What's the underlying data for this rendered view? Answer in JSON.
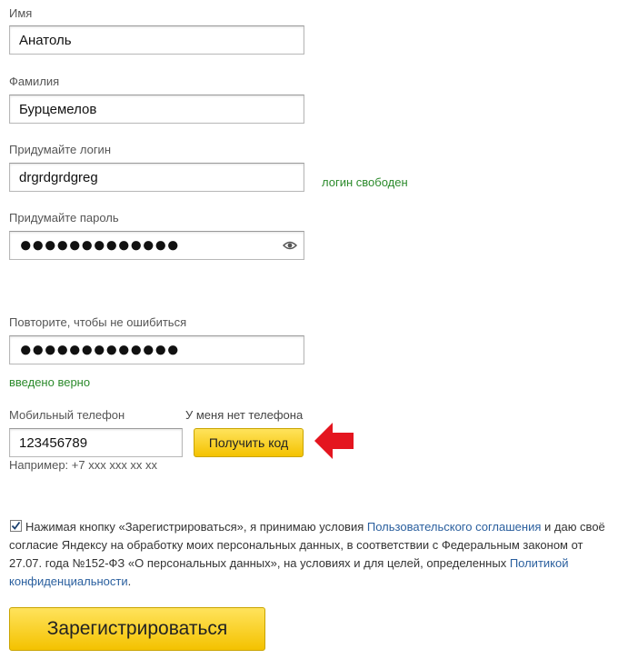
{
  "form": {
    "first_name": {
      "label": "Имя",
      "value": "Анатоль"
    },
    "last_name": {
      "label": "Фамилия",
      "value": "Бурцемелов"
    },
    "login": {
      "label": "Придумайте логин",
      "value": "drgrdgrdgreg",
      "status": "логин свободен"
    },
    "password": {
      "label": "Придумайте пароль",
      "masked": "●●●●●●●●●●●●●",
      "show_icon": "eye-icon"
    },
    "password_repeat": {
      "label": "Повторите, чтобы не ошибиться",
      "masked": "●●●●●●●●●●●●●",
      "status": "введено верно"
    },
    "phone": {
      "label": "Мобильный телефон",
      "no_phone_link": "У меня нет телефона",
      "value": "123456789",
      "get_code_button": "Получить код",
      "example": "Например: +7 xxx xxx xx xx",
      "arrow_icon": "red-arrow-left-icon",
      "arrow_color": "#e4151f"
    },
    "agreement": {
      "checked": true,
      "text_1": "Нажимая кнопку «Зарегистрироваться», я принимаю условия ",
      "link_1": "Пользовательского соглашения",
      "text_2": " и даю своё согласие Яндексу на обработку моих персональных данных, в соответствии с Федеральным законом от 27.07. года №152-ФЗ «О персональных данных», на условиях и для целей, определенных ",
      "link_2": "Политикой конфиденциальности",
      "text_3": "."
    },
    "submit_button": "Зарегистрироваться"
  },
  "colors": {
    "accent_yellow": "#f4c200",
    "success_green": "#2b8a2b",
    "link_blue": "#2a5f9e"
  }
}
